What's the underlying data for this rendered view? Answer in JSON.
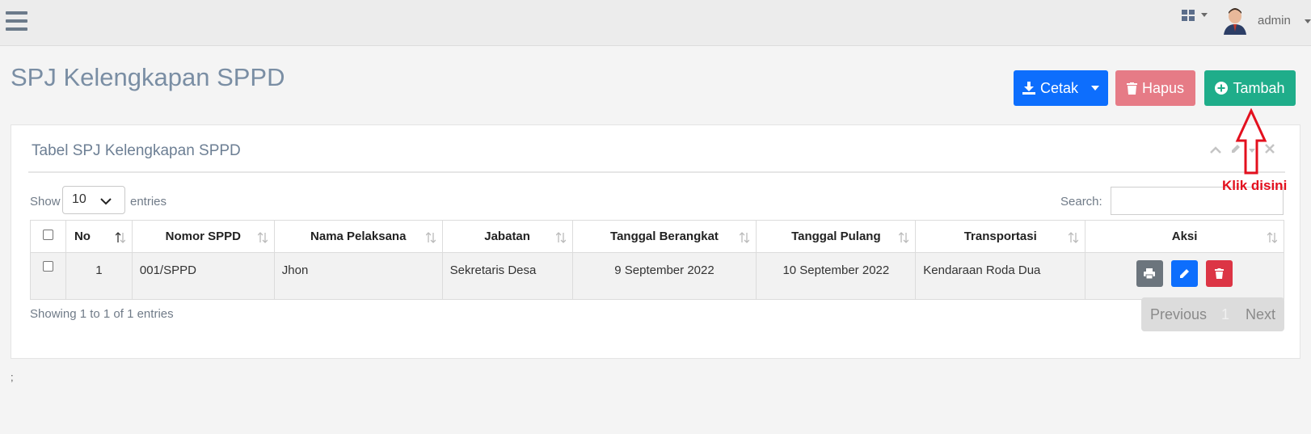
{
  "header": {
    "user_name": "admin",
    "icons": [
      "menu-icon",
      "grid-icon",
      "avatar"
    ]
  },
  "page": {
    "title": "SPJ Kelengkapan SPPD"
  },
  "actions": {
    "cetak_label": "Cetak",
    "hapus_label": "Hapus",
    "tambah_label": "Tambah"
  },
  "panel": {
    "title": "Tabel SPJ Kelengkapan SPPD"
  },
  "table_controls": {
    "show_label": "Show",
    "entries_value": "10",
    "entries_label": "entries",
    "search_label": "Search:",
    "search_value": ""
  },
  "table": {
    "columns": [
      "No",
      "Nomor SPPD",
      "Nama Pelaksana",
      "Jabatan",
      "Tanggal Berangkat",
      "Tanggal Pulang",
      "Transportasi",
      "Aksi"
    ],
    "rows": [
      {
        "no": "1",
        "nomor": "001/SPPD",
        "nama": "Jhon",
        "jabatan": "Sekretaris Desa",
        "berangkat": "9 September 2022",
        "pulang": "10 September 2022",
        "transportasi": "Kendaraan Roda Dua"
      }
    ]
  },
  "footer": {
    "info": "Showing 1 to 1 of 1 entries",
    "previous": "Previous",
    "page": "1",
    "next": "Next",
    "semicolon": ";"
  },
  "annotation": {
    "label": "Klik disini"
  },
  "colors": {
    "primary": "#0d6efd",
    "danger_light": "#e67b86",
    "success": "#1fad8a",
    "secondary": "#6c757d",
    "danger": "#dc3545",
    "annotation": "#e3101e"
  }
}
